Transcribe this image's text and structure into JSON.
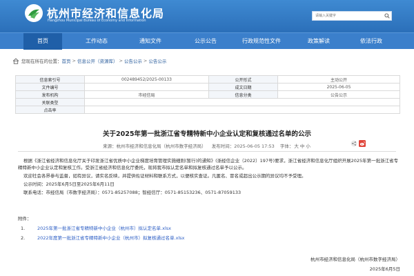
{
  "header": {
    "title": "杭州市经济和信息化局",
    "subtitle": "Hangzhou Municipal Bureau of Economy and Information",
    "search_placeholder": "请输入关键字"
  },
  "nav": {
    "items": [
      {
        "label": "首页"
      },
      {
        "label": "工作动态"
      },
      {
        "label": "通知文件"
      },
      {
        "label": "公示公告"
      },
      {
        "label": "行政规范性文件"
      },
      {
        "label": "政策解读"
      },
      {
        "label": "依法行政"
      }
    ]
  },
  "breadcrumb": {
    "prefix": "您现在所在的位置：",
    "items": [
      "首页",
      "信息公开（资源库）",
      "公告公示",
      "公告公示"
    ],
    "sep": ">"
  },
  "meta": {
    "rows": [
      [
        "信息索引号",
        "002489452/2025-00133",
        "公开形式",
        "主动公开"
      ],
      [
        "文件编号",
        "",
        "成文日期",
        "2025-06-05"
      ],
      [
        "发布机构",
        "市经信局",
        "信息分类",
        "公告公示"
      ],
      [
        "关联类型",
        "",
        "",
        ""
      ],
      [
        "点击率",
        "",
        "",
        ""
      ]
    ]
  },
  "article": {
    "title": "关于2025年第一批浙江省专精特新中小企业认定和复核通过名单的公示",
    "source": "来源：杭州市经济和信息化局（杭州市数字经济局）",
    "published": "发布时间：2025-06-05 17:53",
    "font_label": "字体：",
    "font_large": "大",
    "font_mid": "中",
    "font_small": "小",
    "paragraph1": "根据《浙江省经济和信息化厅关于印发浙江省优质中小企业梯度培育管理实施细则(暂行)的通知》(浙经信企业（2022）197号)要求，浙江省经济和信息化厅组织开展2025年第一批浙江省专精特新中小企业认定和复核工作。受浙江省经济和信息化厅委托，现将我市拟认定名单和拟复核通过名单予以公示。",
    "paragraph2": "欢迎社会各界参与监督，如有异议，请实名反映，并提供佐证材料和联系方式，以便核实查证。凡匿名、冒名或超出公示期的异议均不予受理。",
    "period": "公示时间：2025年6月5日至2025年6月11日",
    "contact": "联系电话：市经信局（市数字经济局）：0571-85257088；智经信厅：0571-85153236、0571-87059133",
    "attach_label": "附件：",
    "attachments": [
      {
        "num": "1.",
        "label": "2025年第一批浙江省专精特新中小企业（杭州市）拟认定名单.xlsx"
      },
      {
        "num": "2.",
        "label": "2022年度第一批浙江省专精特新中小企业（杭州市）拟复核通过名单.xlsx"
      }
    ],
    "sign_org": "杭州市经济和信息化局（杭州市数字经济局）",
    "sign_date": "2025年6月5日"
  },
  "colors": {
    "header_blue": "#3f8ad2",
    "nav_blue": "#3b7fcb",
    "nav_active": "#1f5fa8",
    "link_blue": "#2a5cc4",
    "logo_green": "#2f9a3f"
  }
}
